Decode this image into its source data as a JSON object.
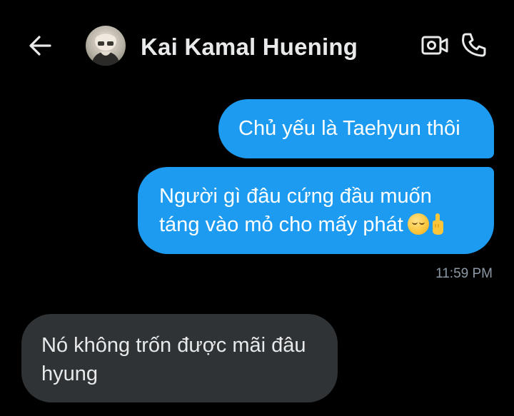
{
  "header": {
    "contact_name": "Kai Kamal Huening",
    "back_icon": "arrow-left-icon",
    "video_icon": "video-call-icon",
    "call_icon": "phone-icon"
  },
  "messages": [
    {
      "direction": "sent",
      "text": "Chủ yếu là Taehyun thôi"
    },
    {
      "direction": "sent",
      "text_line1": "Người gì đâu cứng đầu muốn",
      "text_line2": "táng vào mỏ cho mấy phát",
      "emoji": [
        "pensive-face-icon",
        "middle-finger-icon"
      ]
    },
    {
      "direction": "received",
      "text_line1": "Nó không trốn được mãi đâu",
      "text_line2": "hyung"
    }
  ],
  "sent_timestamp": "11:59 PM",
  "colors": {
    "background": "#000000",
    "sent_bubble": "#1d9bf0",
    "received_bubble": "#2f3336",
    "name_text": "#e7e9ea",
    "timestamp": "#8b98a5"
  }
}
